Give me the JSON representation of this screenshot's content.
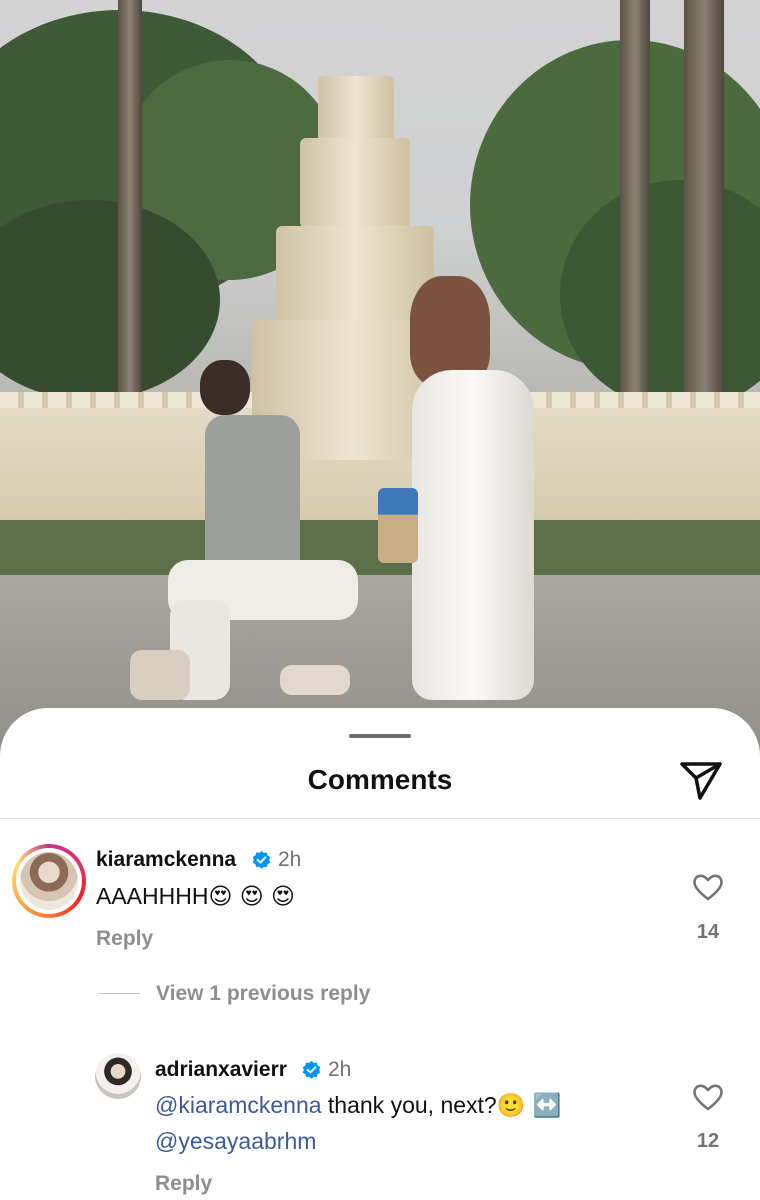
{
  "sheet": {
    "title": "Comments"
  },
  "comments": [
    {
      "username": "kiaramckenna",
      "verified": true,
      "time": "2h",
      "text": "AAAHHHH",
      "emojis": "😍 😍 😍",
      "reply_label": "Reply",
      "likes": "14"
    }
  ],
  "view_replies_label": "View 1 previous reply",
  "replies": [
    {
      "username": "adrianxavierr",
      "verified": true,
      "time": "2h",
      "mention": "@kiaramckenna",
      "text": " thank you, next?",
      "emojis": "🙂 ↔️",
      "mention2": "@yesayaabrhm",
      "reply_label": "Reply",
      "likes": "12"
    }
  ],
  "colors": {
    "mention": "#3b5a9a",
    "secondary_text": "#8e8e8e",
    "verified_badge": "#0095f6"
  }
}
